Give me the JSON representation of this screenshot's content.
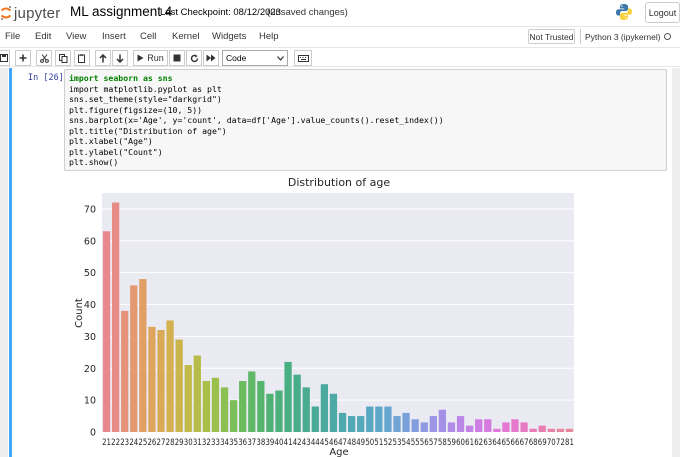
{
  "header": {
    "logo_text": "jupyter",
    "notebook_title": "ML assignment 4",
    "checkpoint": "Last Checkpoint: 08/12/2023",
    "autosave_status": "(unsaved changes)",
    "logout_label": "Logout",
    "logo_icon": "jupyter-logo-icon",
    "python_icon": "python-logo-icon"
  },
  "menubar": {
    "items": [
      "File",
      "Edit",
      "View",
      "Insert",
      "Cell",
      "Kernel",
      "Widgets",
      "Help"
    ],
    "trusted_label": "Not Trusted",
    "kernel_label": "Python 3 (ipykernel)"
  },
  "toolbar": {
    "run_label": "Run",
    "cell_type": "Code"
  },
  "cell": {
    "prompt": "In [26]:",
    "code_lines": [
      "import seaborn as sns",
      "import matplotlib.pyplot as plt",
      "sns.set_theme(style=\"darkgrid\")",
      "plt.figure(figsize=(10, 5))",
      "sns.barplot(x='Age', y='count', data=df['Age'].value_counts().reset_index())",
      "plt.title(\"Distribution of age\")",
      "plt.xlabel(\"Age\")",
      "plt.ylabel(\"Count\")",
      "plt.show()"
    ]
  },
  "chart_data": {
    "type": "bar",
    "title": "Distribution of age",
    "xlabel": "Age",
    "ylabel": "Count",
    "ylim": [
      0,
      75
    ],
    "yticks": [
      0,
      10,
      20,
      30,
      40,
      50,
      60,
      70
    ],
    "grid": true,
    "categories": [
      "21",
      "22",
      "23",
      "24",
      "25",
      "26",
      "27",
      "28",
      "29",
      "30",
      "31",
      "32",
      "33",
      "34",
      "35",
      "36",
      "37",
      "38",
      "39",
      "40",
      "41",
      "42",
      "43",
      "44",
      "45",
      "46",
      "47",
      "48",
      "49",
      "50",
      "51",
      "52",
      "53",
      "54",
      "55",
      "56",
      "57",
      "58",
      "59",
      "60",
      "61",
      "62",
      "63",
      "64",
      "65",
      "66",
      "67",
      "68",
      "69",
      "70",
      "72",
      "81"
    ],
    "values": [
      63,
      72,
      38,
      46,
      48,
      33,
      32,
      35,
      29,
      21,
      24,
      16,
      17,
      14,
      10,
      16,
      19,
      16,
      12,
      13,
      22,
      18,
      14,
      8,
      15,
      12,
      6,
      5,
      5,
      8,
      8,
      8,
      5,
      6,
      4,
      3,
      5,
      7,
      3,
      5,
      2,
      4,
      4,
      1,
      3,
      4,
      3,
      1,
      2,
      1,
      1,
      1
    ],
    "colors": [
      "#e8888e",
      "#e88d85",
      "#e6927a",
      "#e49970",
      "#e19f66",
      "#dea55d",
      "#d9ab57",
      "#d3b050",
      "#cbb54b",
      "#c1b948",
      "#b6bc47",
      "#aabf48",
      "#9cc04c",
      "#8cc052",
      "#7cbe58",
      "#6cbb5f",
      "#5fb866",
      "#55b56d",
      "#4fb274",
      "#4bb07b",
      "#4aae83",
      "#49ac8a",
      "#49ab91",
      "#49aa98",
      "#4aaa9f",
      "#4ca9a6",
      "#4da9ad",
      "#50a9b4",
      "#54a9bb",
      "#59a8c2",
      "#5fa7c8",
      "#66a6cf",
      "#6fa4d4",
      "#78a1da",
      "#839ede",
      "#8e9ae2",
      "#9a95e5",
      "#a590e7",
      "#b08be8",
      "#bb86e8",
      "#c582e6",
      "#ce7ee3",
      "#d67bdf",
      "#dd79da",
      "#e379d3",
      "#e679cb",
      "#e87ac2",
      "#e97cb9",
      "#e97fb0",
      "#e982a7",
      "#e9859e",
      "#e98896"
    ]
  }
}
